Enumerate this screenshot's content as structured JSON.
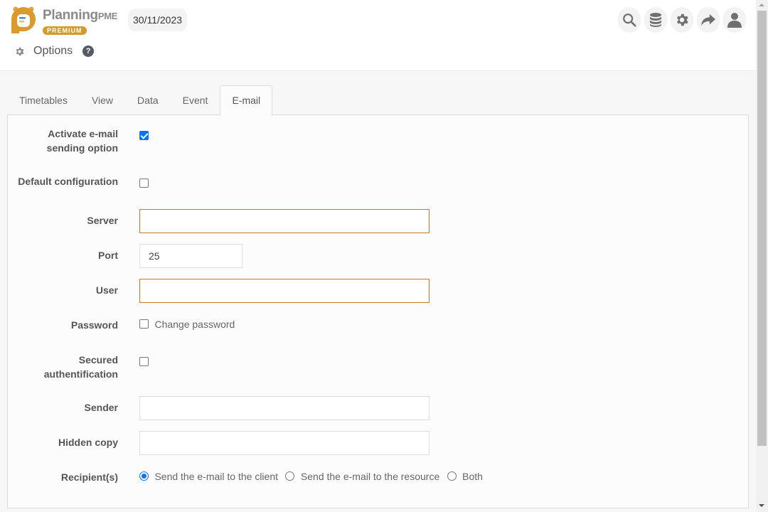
{
  "header": {
    "brand_name": "Planning",
    "brand_suffix": "PME",
    "brand_badge": "PREMIUM",
    "date": "30/11/2023",
    "page_title": "Options",
    "help": "?",
    "icons": [
      "search-icon",
      "database-icon",
      "gear-icon",
      "share-icon",
      "user-icon"
    ]
  },
  "tabs": [
    {
      "label": "Timetables",
      "active": false
    },
    {
      "label": "View",
      "active": false
    },
    {
      "label": "Data",
      "active": false
    },
    {
      "label": "Event",
      "active": false
    },
    {
      "label": "E-mail",
      "active": true
    }
  ],
  "form": {
    "activate": {
      "label_line1": "Activate e-mail",
      "label_line2": "sending option",
      "checked": true
    },
    "default_config": {
      "label": "Default configuration",
      "checked": false
    },
    "server": {
      "label": "Server",
      "value": ""
    },
    "port": {
      "label": "Port",
      "value": "25"
    },
    "user": {
      "label": "User",
      "value": ""
    },
    "password": {
      "label": "Password",
      "change_label": "Change password",
      "checked": false
    },
    "secured": {
      "label_line1": "Secured",
      "label_line2": "authentification",
      "checked": false
    },
    "sender": {
      "label": "Sender",
      "value": ""
    },
    "hidden_copy": {
      "label": "Hidden copy",
      "value": ""
    },
    "recipients": {
      "label": "Recipient(s)",
      "options": [
        {
          "label": "Send the e-mail to the client",
          "checked": true
        },
        {
          "label": "Send the e-mail to the resource",
          "checked": false
        },
        {
          "label": "Both",
          "checked": false
        }
      ]
    }
  },
  "colors": {
    "accent": "#0075ff",
    "required_border": "#c8782d",
    "brand": "#d59a2c"
  }
}
